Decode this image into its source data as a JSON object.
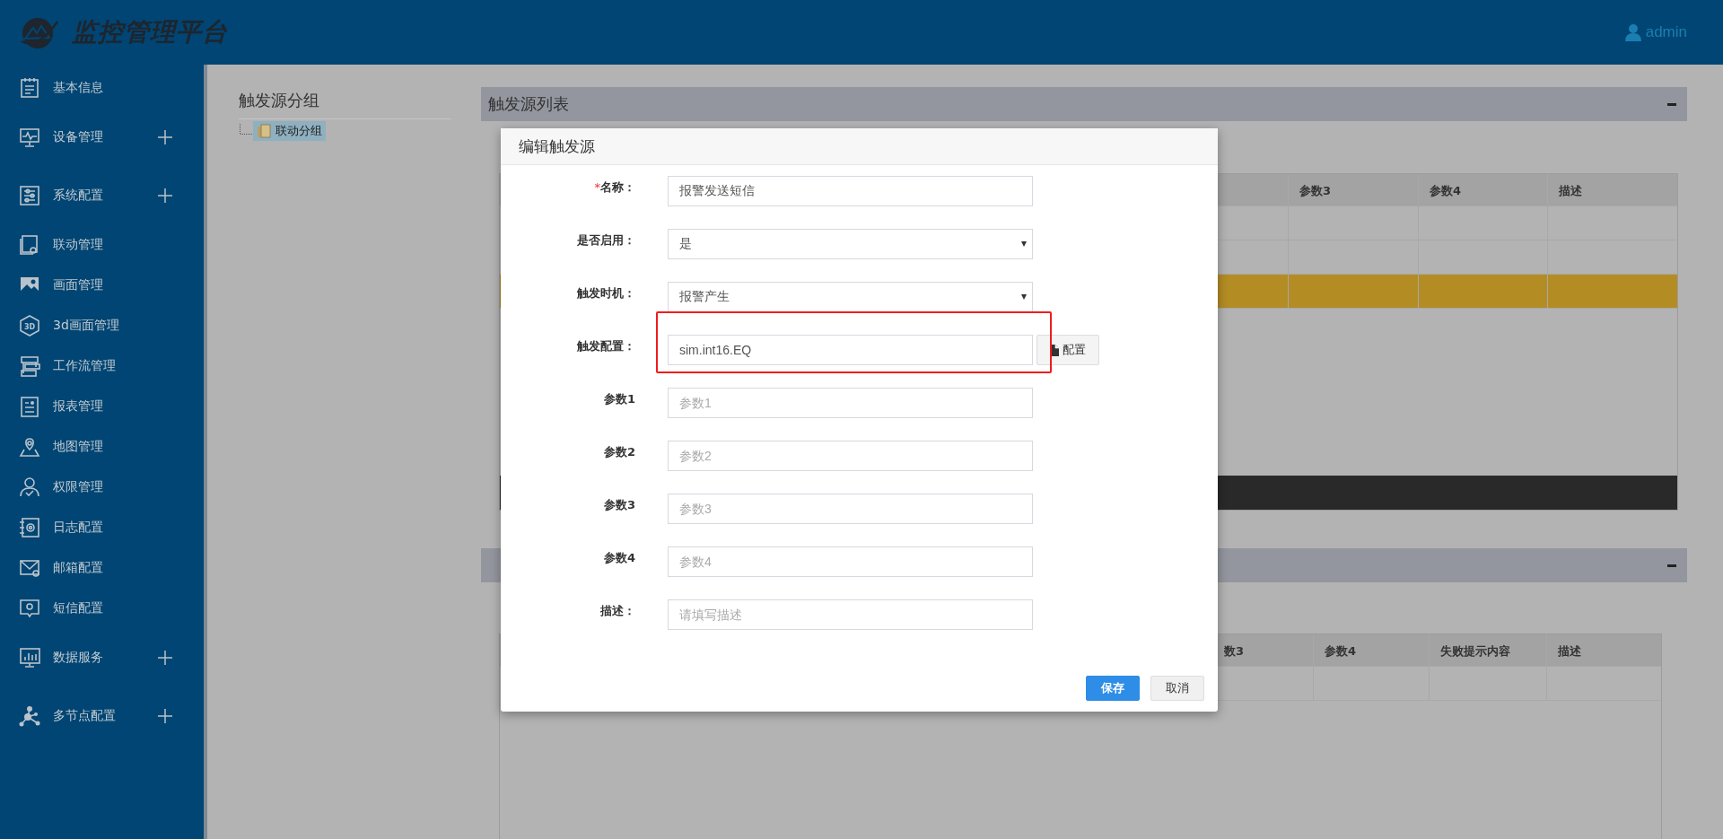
{
  "header": {
    "title": "监控管理平台",
    "user": "admin"
  },
  "sidebar": {
    "items": [
      {
        "label": "基本信息",
        "expandable": false
      },
      {
        "label": "设备管理",
        "expandable": true
      },
      {
        "label": "系统配置",
        "expandable": true
      },
      {
        "label": "联动管理",
        "expandable": false
      },
      {
        "label": "画面管理",
        "expandable": false
      },
      {
        "label": "3d画面管理",
        "expandable": false,
        "icon_text": "3D"
      },
      {
        "label": "工作流管理",
        "expandable": false
      },
      {
        "label": "报表管理",
        "expandable": false
      },
      {
        "label": "地图管理",
        "expandable": false
      },
      {
        "label": "权限管理",
        "expandable": false
      },
      {
        "label": "日志配置",
        "expandable": false
      },
      {
        "label": "邮箱配置",
        "expandable": false
      },
      {
        "label": "短信配置",
        "expandable": false
      },
      {
        "label": "数据服务",
        "expandable": true
      },
      {
        "label": "多节点配置",
        "expandable": true
      }
    ]
  },
  "group_panel": {
    "title": "触发源分组",
    "tree": [
      {
        "label": "联动分组",
        "selected": true
      }
    ]
  },
  "list_panel": {
    "title": "触发源列表",
    "table": {
      "columns": [
        "参数3",
        "参数4",
        "描述"
      ],
      "rows": [
        {
          "selected": false
        },
        {
          "selected": false
        },
        {
          "selected": true
        }
      ]
    }
  },
  "config_panel": {
    "table": {
      "columns": [
        "数3",
        "参数4",
        "失败提示内容",
        "描述"
      ],
      "rows": [
        {
          "selected": false
        }
      ]
    }
  },
  "dialog": {
    "title": "编辑触发源",
    "fields": [
      {
        "kind": "text",
        "required_mark": "*",
        "label": "名称：",
        "value": "报警发送短信"
      },
      {
        "kind": "select",
        "label": "是否启用：",
        "value": "是"
      },
      {
        "kind": "select",
        "label": "触发时机：",
        "value": "报警产生"
      },
      {
        "kind": "text",
        "label": "触发配置：",
        "value": "sim.int16.EQ",
        "button": "配置",
        "highlighted": true
      },
      {
        "kind": "text",
        "label": "参数1",
        "placeholder": "参数1"
      },
      {
        "kind": "text",
        "label": "参数2",
        "placeholder": "参数2"
      },
      {
        "kind": "text",
        "label": "参数3",
        "placeholder": "参数3"
      },
      {
        "kind": "text",
        "label": "参数4",
        "placeholder": "参数4"
      },
      {
        "kind": "text",
        "label": "描述：",
        "placeholder": "请填写描述"
      }
    ],
    "buttons": [
      {
        "label": "保存",
        "primary": true
      },
      {
        "label": "取消",
        "primary": false
      }
    ]
  }
}
